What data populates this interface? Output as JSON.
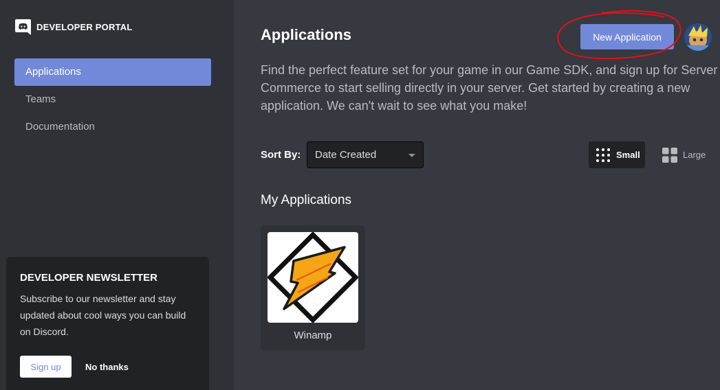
{
  "brand": {
    "text": "DEVELOPER PORTAL"
  },
  "sidebar": {
    "items": [
      {
        "label": "Applications",
        "active": true
      },
      {
        "label": "Teams",
        "active": false
      },
      {
        "label": "Documentation",
        "active": false
      }
    ]
  },
  "newsletter": {
    "title": "DEVELOPER NEWSLETTER",
    "body": "Subscribe to our newsletter and stay updated about cool ways you can build on Discord.",
    "signup_label": "Sign up",
    "decline_label": "No thanks"
  },
  "main": {
    "title": "Applications",
    "new_button_label": "New Application",
    "intro": "Find the perfect feature set for your game in our Game SDK, and sign up for Server Commerce to start selling directly in your server. Get started by creating a new application. We can't wait to see what you make!",
    "sort": {
      "label": "Sort By:",
      "value": "Date Created"
    },
    "view": {
      "small_label": "Small",
      "large_label": "Large",
      "selected": "Small"
    },
    "section_title": "My Applications",
    "apps": [
      {
        "name": "Winamp",
        "icon": "winamp-lightning-icon"
      }
    ]
  },
  "icons": {
    "brand": "discord-logo-icon",
    "avatar": "user-avatar",
    "sort_caret": "chevron-down-icon",
    "view_small": "grid-small-icon",
    "view_large": "grid-large-icon"
  },
  "colors": {
    "accent": "#7289da",
    "sidebar_bg": "#2f3136",
    "main_bg": "#36393f",
    "panel_dark": "#202225",
    "annotation": "#e0101a"
  }
}
